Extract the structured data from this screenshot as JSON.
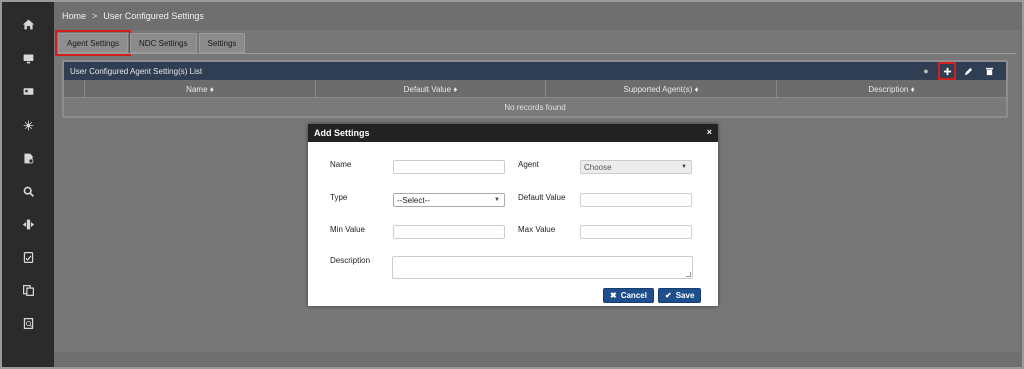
{
  "breadcrumb": {
    "home": "Home",
    "separator": ">",
    "current": "User Configured Settings"
  },
  "tabs": [
    {
      "label": "Agent Settings",
      "active": true
    },
    {
      "label": "NDC Settings",
      "active": false
    },
    {
      "label": "Settings",
      "active": false
    }
  ],
  "grid": {
    "title": "User Configured Agent Setting(s) List",
    "columns": [
      "Name ♦",
      "Default Value ♦",
      "Supported Agent(s) ♦",
      "Description ♦"
    ],
    "empty_message": "No records found",
    "tools": [
      "help-icon",
      "add-icon",
      "edit-icon",
      "delete-icon"
    ]
  },
  "sidebar": {
    "icons": [
      "home-icon",
      "monitor-icon",
      "card-icon",
      "network-icon",
      "report-icon",
      "search-icon",
      "flow-icon",
      "document-icon",
      "documents-icon",
      "audit-icon"
    ]
  },
  "modal": {
    "title": "Add Settings",
    "close": "×",
    "name_label": "Name",
    "name_value": "",
    "agent_label": "Agent",
    "agent_value": "Choose",
    "type_label": "Type",
    "type_value": "--Select--",
    "default_label": "Default Value",
    "default_value": "",
    "min_label": "Min Value",
    "min_value": "",
    "max_label": "Max Value",
    "max_value": "",
    "description_label": "Description",
    "description_value": "",
    "cancel_label": "Cancel",
    "save_label": "Save"
  },
  "colors": {
    "accent": "#1e4f8c",
    "highlight": "#d01f1f",
    "grid_header": "#2f3e52"
  }
}
